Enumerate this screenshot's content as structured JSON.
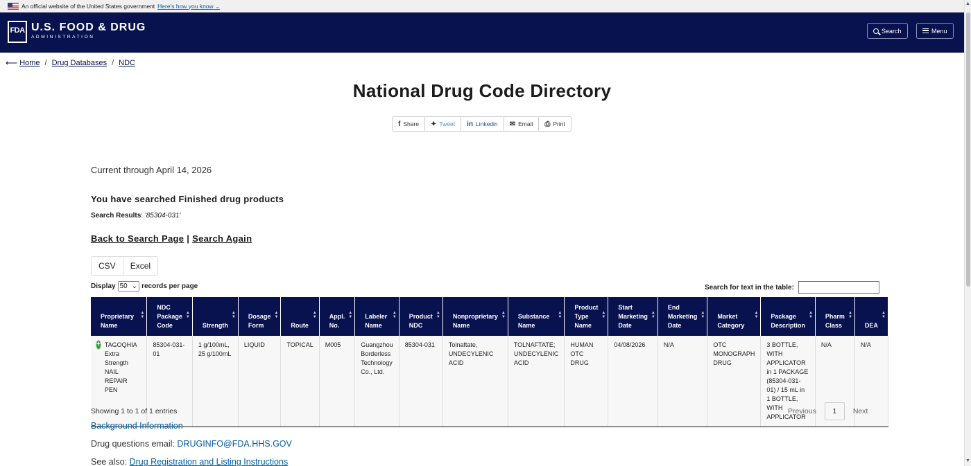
{
  "gov_banner": {
    "text": "An official website of the United States government",
    "link": "Here's how you know"
  },
  "header": {
    "logo_box": "FDA",
    "logo_main": "U.S. FOOD & DRUG",
    "logo_sub": "ADMINISTRATION",
    "search_label": "Search",
    "menu_label": "Menu"
  },
  "breadcrumb": {
    "home": "Home",
    "sep": "/",
    "databases": "Drug Databases",
    "ndc": "NDC"
  },
  "page_title": "National Drug Code Directory",
  "share": {
    "share": "Share",
    "tweet": "Tweet",
    "linkedin": "Linkedin",
    "email": "Email",
    "print": "Print"
  },
  "current_through": "Current through April 14, 2026",
  "searched_heading": "You have searched Finished drug products",
  "search_results": {
    "label": "Search Results",
    "colon": ":",
    "query": "'85304-031'"
  },
  "back_links": {
    "back": "Back to Search Page",
    "sep": "|",
    "again": "Search Again"
  },
  "export": {
    "csv": "CSV",
    "excel": "Excel"
  },
  "display": {
    "label": "Display",
    "value": "50",
    "suffix": "records per page"
  },
  "table_search_label": "Search for text in the table:",
  "table": {
    "headers": [
      "Proprietary Name",
      "NDC Package Code",
      "Strength",
      "Dosage Form",
      "Route",
      "Appl. No.",
      "Labeler Name",
      "Product NDC",
      "Nonproprietary Name",
      "Substance Name",
      "Product Type Name",
      "Start Marketing Date",
      "End Marketing Date",
      "Market Category",
      "Package Description",
      "Pharm Class",
      "DEA"
    ],
    "rows": [
      [
        "TAGOQHIA Extra Strength NAIL REPAIR PEN",
        "85304-031-01",
        "1 g/100mL, 25 g/100mL",
        "LIQUID",
        "TOPICAL",
        "M005",
        "Guangzhou Borderless Technology Co., Ltd.",
        "85304-031",
        "Tolnaftate, UNDECYLENIC ACID",
        "TOLNAFTATE; UNDECYLENIC ACID",
        "HUMAN OTC DRUG",
        "04/08/2026",
        "N/A",
        "OTC MONOGRAPH DRUG",
        "3 BOTTLE, WITH APPLICATOR in 1 PACKAGE (85304-031-01) / 15 mL in 1 BOTTLE, WITH APPLICATOR",
        "N/A",
        "N/A"
      ]
    ]
  },
  "showing": "Showing 1 to 1 of 1 entries",
  "pager": {
    "previous": "Previous",
    "current": "1",
    "next": "Next"
  },
  "background_info": "Background Information",
  "drug_questions": {
    "label": "Drug questions email:",
    "email": "DRUGINFO@FDA.HHS.GOV"
  },
  "see_also": {
    "label": "See also:",
    "link": "Drug Registration and Listing Instructions"
  }
}
